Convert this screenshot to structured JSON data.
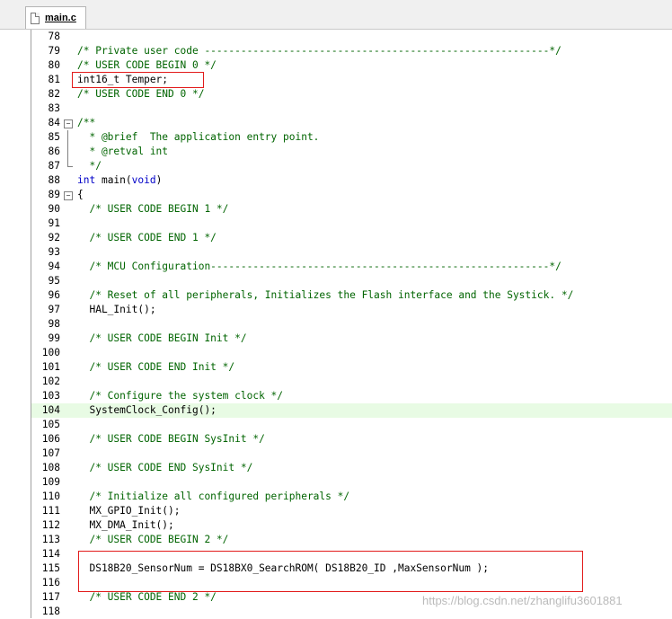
{
  "tab": {
    "label": "main.c",
    "icon": "c-file-icon"
  },
  "lines": [
    {
      "num": "78",
      "text": ""
    },
    {
      "num": "79",
      "text": "/* Private user code ---------------------------------------------------------*/"
    },
    {
      "num": "80",
      "text": "/* USER CODE BEGIN 0 */"
    },
    {
      "num": "81",
      "text": "int16_t Temper;"
    },
    {
      "num": "82",
      "text": "/* USER CODE END 0 */"
    },
    {
      "num": "83",
      "text": ""
    },
    {
      "num": "84",
      "text": "/**"
    },
    {
      "num": "85",
      "text": "  * @brief  The application entry point."
    },
    {
      "num": "86",
      "text": "  * @retval int"
    },
    {
      "num": "87",
      "text": "  */"
    },
    {
      "num": "88",
      "text": "int main(void)"
    },
    {
      "num": "89",
      "text": "{"
    },
    {
      "num": "90",
      "text": "  /* USER CODE BEGIN 1 */"
    },
    {
      "num": "91",
      "text": ""
    },
    {
      "num": "92",
      "text": "  /* USER CODE END 1 */"
    },
    {
      "num": "93",
      "text": ""
    },
    {
      "num": "94",
      "text": "  /* MCU Configuration--------------------------------------------------------*/"
    },
    {
      "num": "95",
      "text": ""
    },
    {
      "num": "96",
      "text": "  /* Reset of all peripherals, Initializes the Flash interface and the Systick. */"
    },
    {
      "num": "97",
      "text": "  HAL_Init();"
    },
    {
      "num": "98",
      "text": ""
    },
    {
      "num": "99",
      "text": "  /* USER CODE BEGIN Init */"
    },
    {
      "num": "100",
      "text": ""
    },
    {
      "num": "101",
      "text": "  /* USER CODE END Init */"
    },
    {
      "num": "102",
      "text": ""
    },
    {
      "num": "103",
      "text": "  /* Configure the system clock */"
    },
    {
      "num": "104",
      "text": "  SystemClock_Config();"
    },
    {
      "num": "105",
      "text": ""
    },
    {
      "num": "106",
      "text": "  /* USER CODE BEGIN SysInit */"
    },
    {
      "num": "107",
      "text": ""
    },
    {
      "num": "108",
      "text": "  /* USER CODE END SysInit */"
    },
    {
      "num": "109",
      "text": ""
    },
    {
      "num": "110",
      "text": "  /* Initialize all configured peripherals */"
    },
    {
      "num": "111",
      "text": "  MX_GPIO_Init();"
    },
    {
      "num": "112",
      "text": "  MX_DMA_Init();"
    },
    {
      "num": "113",
      "text": "  /* USER CODE BEGIN 2 */"
    },
    {
      "num": "114",
      "text": ""
    },
    {
      "num": "115",
      "text": "  DS18B20_SensorNum = DS18BX0_SearchROM( DS18B20_ID ,MaxSensorNum );"
    },
    {
      "num": "116",
      "text": ""
    },
    {
      "num": "117",
      "text": "  /* USER CODE END 2 */"
    },
    {
      "num": "118",
      "text": ""
    }
  ],
  "watermark": "https://blog.csdn.net/zhanglifu3601881",
  "colors": {
    "comment": "#006400",
    "keyword": "#0000c8",
    "highlight": "#e8fbe4",
    "box": "#e21b1b"
  }
}
